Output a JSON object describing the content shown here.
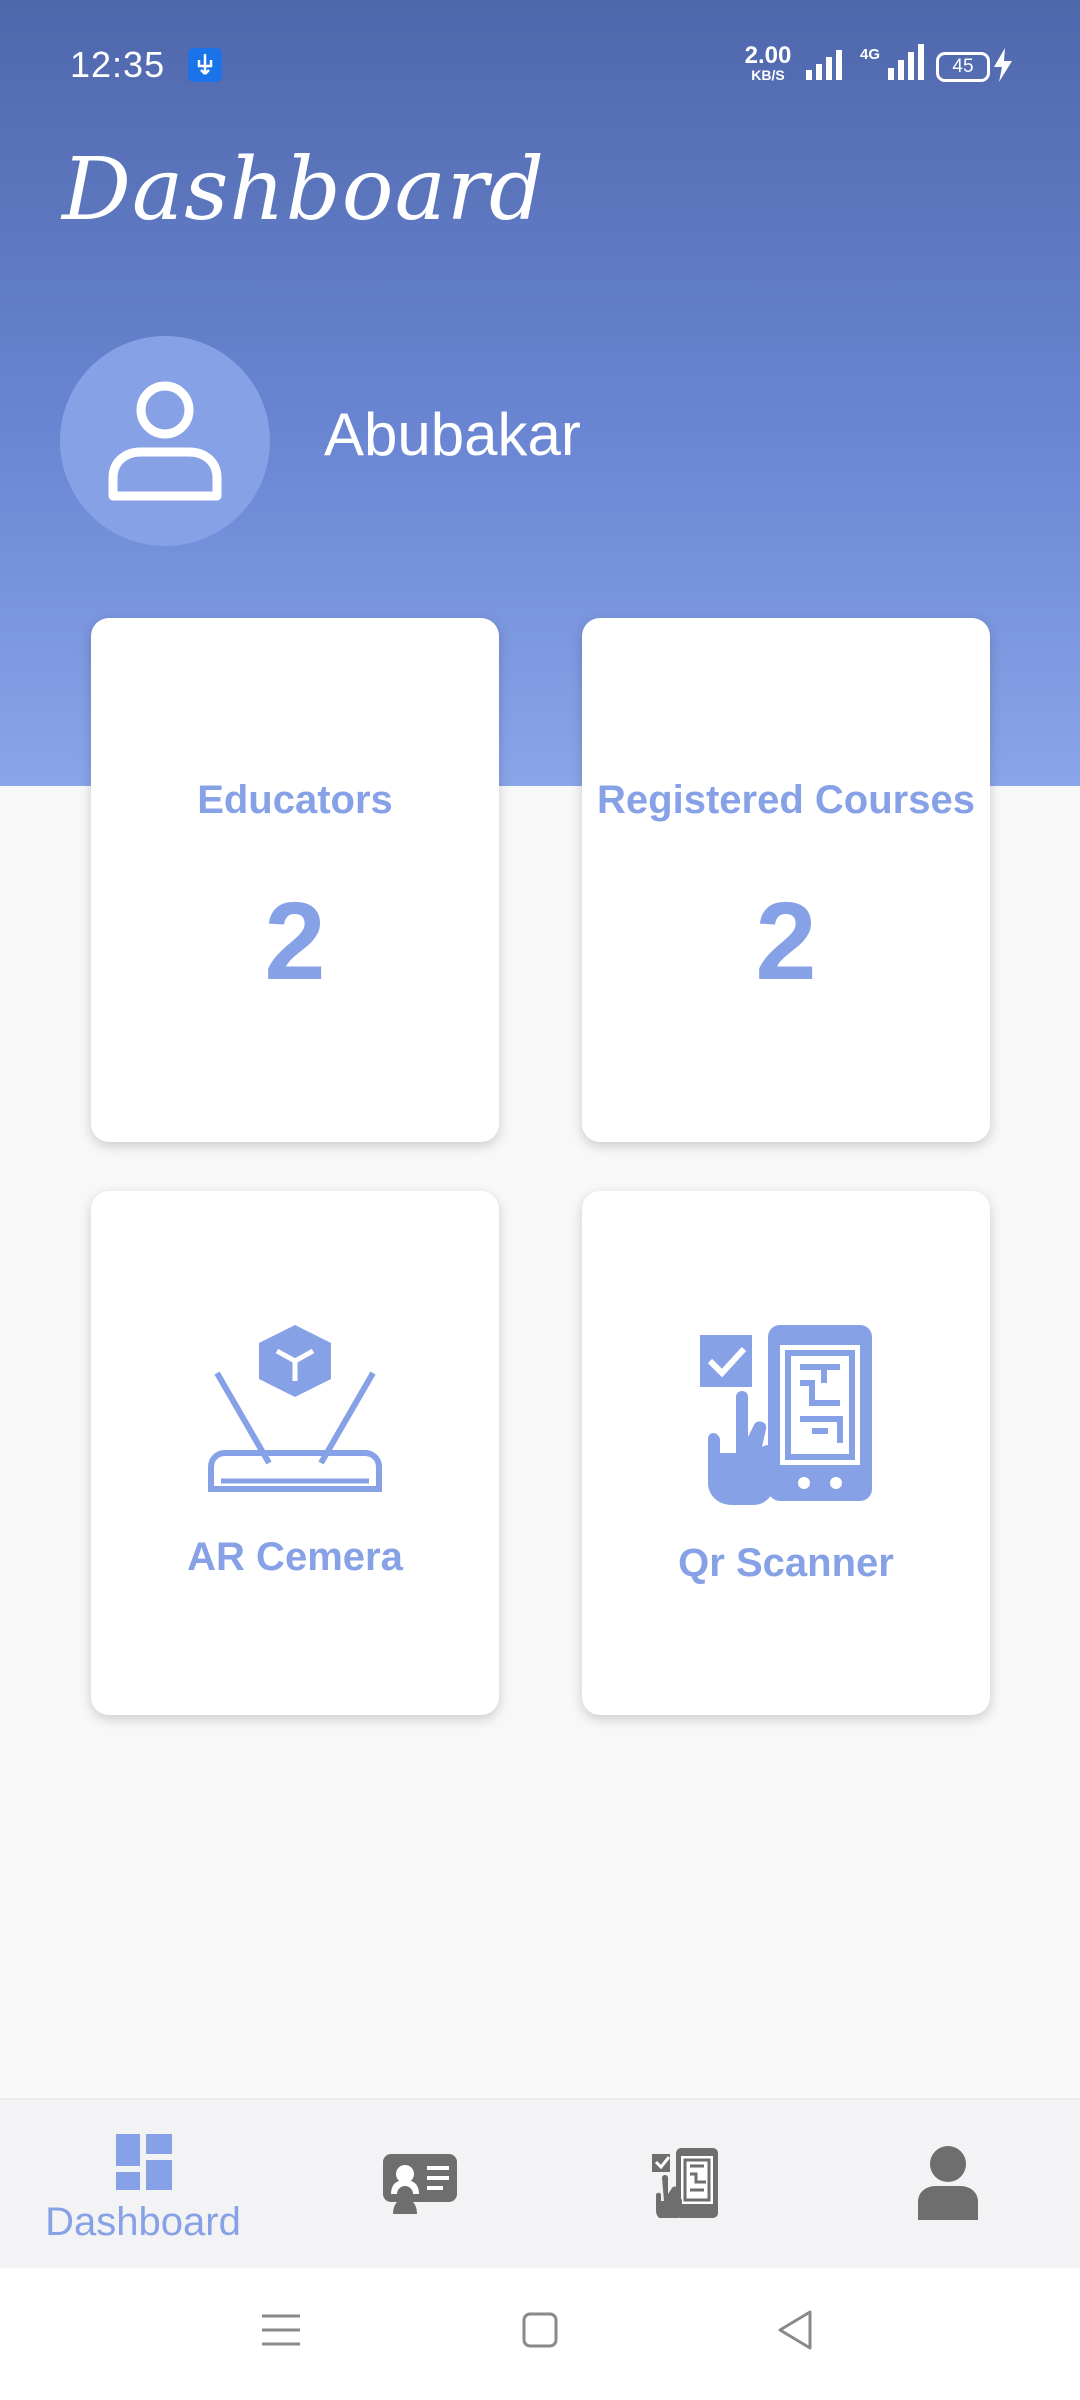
{
  "status_bar": {
    "time": "12:35",
    "net_speed_value": "2.00",
    "net_speed_unit": "KB/S",
    "network_type": "4G",
    "battery_level": "45"
  },
  "header": {
    "title": "Dashboard",
    "user_name": "Abubakar"
  },
  "cards": {
    "educators": {
      "label": "Educators",
      "value": "2"
    },
    "courses": {
      "label": "Registered Courses",
      "value": "2"
    },
    "ar_camera": {
      "label": "AR Cemera",
      "icon": "ar-hologram-icon"
    },
    "qr_scanner": {
      "label": "Qr Scanner",
      "icon": "qr-scan-icon"
    }
  },
  "bottom_nav": {
    "items": [
      {
        "label": "Dashboard",
        "icon": "dashboard-icon",
        "active": true
      },
      {
        "icon": "id-card-icon"
      },
      {
        "icon": "qr-phone-icon"
      },
      {
        "icon": "profile-icon"
      }
    ]
  },
  "colors": {
    "accent": "#87a1e6",
    "header_top": "#4f67ab",
    "header_bottom": "#8aa5ea",
    "inactive_icon": "#6e6e6e"
  }
}
